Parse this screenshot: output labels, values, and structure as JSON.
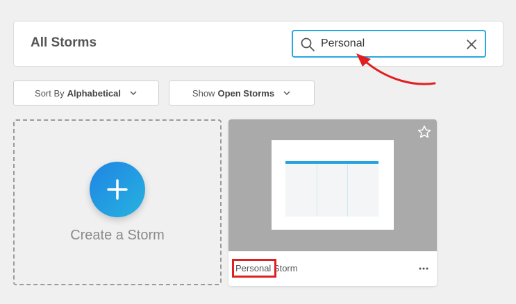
{
  "header": {
    "title": "All Storms"
  },
  "search": {
    "value": "Personal",
    "icon": "search-icon",
    "clear_icon": "close-icon",
    "border_color": "#2aa7df"
  },
  "filters": {
    "sort": {
      "prefix": "Sort By",
      "value": "Alphabetical",
      "icon": "chevron-down-icon"
    },
    "show": {
      "prefix": "Show",
      "value": "Open Storms",
      "icon": "chevron-down-icon"
    }
  },
  "create_card": {
    "label": "Create a Storm",
    "icon": "plus-icon",
    "gradient": [
      "#1f84e4",
      "#27b3df"
    ]
  },
  "storms": [
    {
      "title_match": "Personal",
      "title_rest": " Storm",
      "star_icon": "star-icon",
      "menu_icon": "more-icon"
    }
  ],
  "annotations": {
    "arrow_color": "#e02020",
    "highlight_color": "#e02020"
  }
}
